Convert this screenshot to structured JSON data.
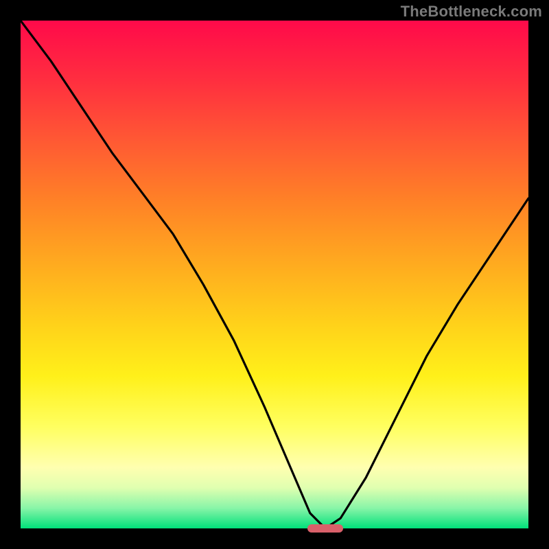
{
  "watermark": {
    "text": "TheBottleneck.com"
  },
  "colors": {
    "curve": "#000000",
    "marker": "#d9606a",
    "frame": "#000000"
  },
  "chart_data": {
    "type": "line",
    "title": "",
    "xlabel": "",
    "ylabel": "",
    "xlim": [
      0,
      100
    ],
    "ylim": [
      0,
      100
    ],
    "series": [
      {
        "name": "bottleneck-curve",
        "x": [
          0,
          6,
          12,
          18,
          24,
          30,
          36,
          42,
          48,
          54,
          57,
          60,
          63,
          68,
          74,
          80,
          86,
          92,
          100
        ],
        "y": [
          100,
          92,
          83,
          74,
          66,
          58,
          48,
          37,
          24,
          10,
          3,
          0,
          2,
          10,
          22,
          34,
          44,
          53,
          65
        ]
      }
    ],
    "marker": {
      "x": 60,
      "y": 0,
      "width_pct": 7,
      "height_pct": 1.6
    },
    "gradient_stops": [
      {
        "pct": 0,
        "color": "#ff0a4a"
      },
      {
        "pct": 12,
        "color": "#ff2f3f"
      },
      {
        "pct": 24,
        "color": "#ff5a33"
      },
      {
        "pct": 36,
        "color": "#ff8326"
      },
      {
        "pct": 48,
        "color": "#ffab1f"
      },
      {
        "pct": 60,
        "color": "#ffd21a"
      },
      {
        "pct": 70,
        "color": "#fff01a"
      },
      {
        "pct": 80,
        "color": "#ffff60"
      },
      {
        "pct": 88,
        "color": "#ffffb0"
      },
      {
        "pct": 92,
        "color": "#e0ffb0"
      },
      {
        "pct": 96,
        "color": "#88f5a8"
      },
      {
        "pct": 100,
        "color": "#00e07a"
      }
    ]
  }
}
